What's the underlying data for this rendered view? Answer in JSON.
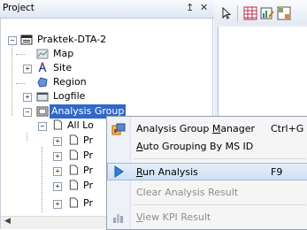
{
  "panel": {
    "title": "Project",
    "pin_glyph": "↥",
    "close_glyph": "✕"
  },
  "tree": {
    "root": "Praktek-DTA-2",
    "map": "Map",
    "site": "Site",
    "region": "Region",
    "logfile": "Logfile",
    "analysis_group": "Analysis Group",
    "all_logs": "All Lo",
    "children": [
      "Pr",
      "Pr",
      "Pr",
      "Pr",
      "Pr"
    ]
  },
  "context_menu": {
    "items": [
      {
        "label_pre": "Analysis Group ",
        "label_ul": "M",
        "label_post": "anager",
        "shortcut": "Ctrl+G",
        "icon": "analysis-group-manager-icon"
      },
      {
        "label_pre": "",
        "label_ul": "A",
        "label_post": "uto Grouping By MS ID",
        "shortcut": "",
        "icon": ""
      },
      {
        "label_pre": "",
        "label_ul": "R",
        "label_post": "un Analysis",
        "shortcut": "F9",
        "icon": "run-arrow-icon"
      },
      {
        "label_pre": "Clear Analysis Result",
        "label_ul": "",
        "label_post": "",
        "shortcut": "",
        "icon": ""
      },
      {
        "label_pre": "",
        "label_ul": "V",
        "label_post": "iew KPI Result",
        "shortcut": "",
        "icon": "kpi-chart-icon"
      }
    ]
  },
  "colors": {
    "selection": "#3169c6",
    "menu_hover": "#cfdff3",
    "run_arrow": "#2f7fd8"
  }
}
